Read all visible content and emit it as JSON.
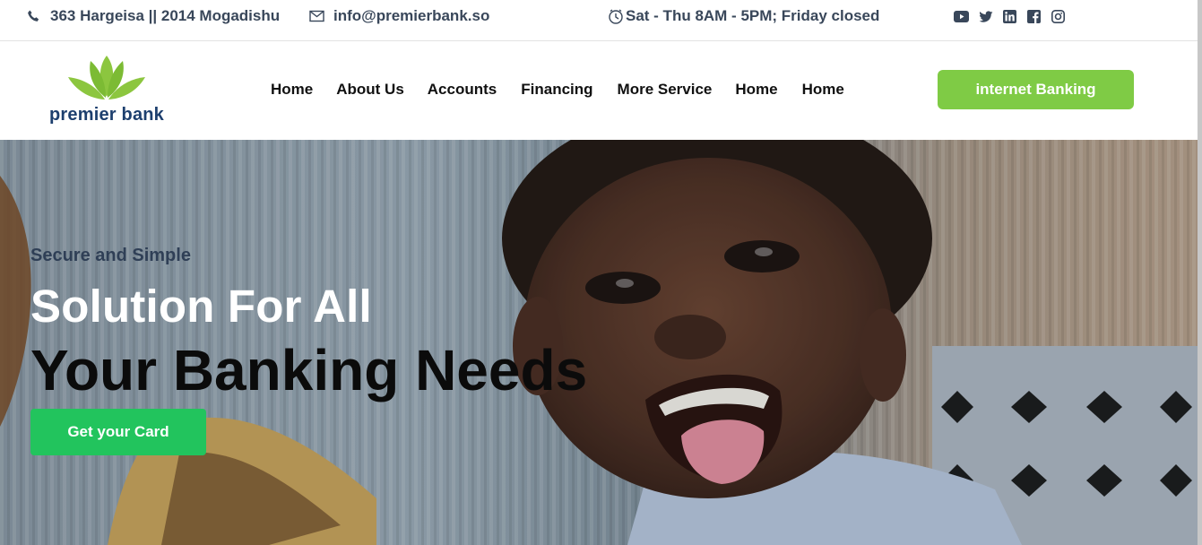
{
  "topbar": {
    "phone": "363 Hargeisa || 2014 Mogadishu",
    "email": "info@premierbank.so",
    "hours": "Sat - Thu 8AM - 5PM; Friday closed",
    "social": [
      "youtube-icon",
      "twitter-icon",
      "linkedin-icon",
      "facebook-icon",
      "instagram-icon"
    ]
  },
  "header": {
    "logo_text": "premier bank",
    "nav": [
      "Home",
      "About Us",
      "Accounts",
      "Financing",
      "More Service",
      "Home",
      "Home"
    ],
    "internet_banking": "internet Banking"
  },
  "hero": {
    "eyebrow": "Secure and Simple",
    "line1": "Solution For All",
    "line2": "Your Banking Needs",
    "cta": "Get your Card"
  },
  "colors": {
    "brand_green": "#7fcb45",
    "cta_green": "#22c45d",
    "logo_blue": "#1d3f6e",
    "topbar_text": "#39475a"
  }
}
